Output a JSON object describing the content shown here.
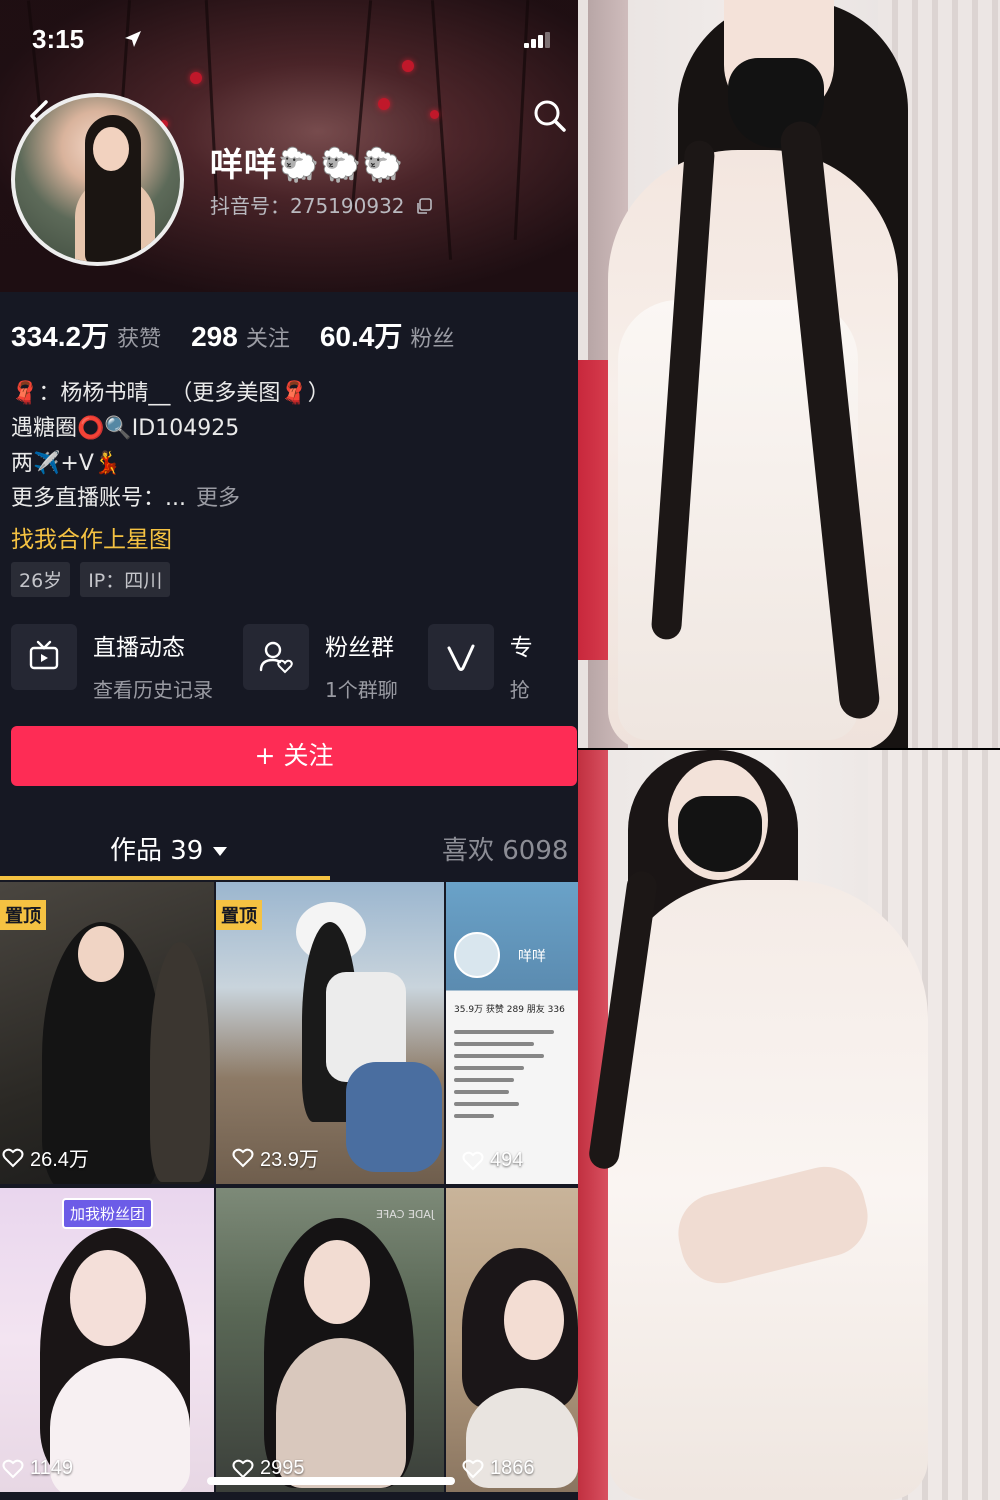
{
  "status_bar": {
    "time": "3:15"
  },
  "profile": {
    "nickname": "咩咩🐑🐑🐑",
    "douyin_id": "抖音号：275190932",
    "stats": [
      {
        "value": "334.2万",
        "label": "获赞"
      },
      {
        "value": "298",
        "label": "关注"
      },
      {
        "value": "60.4万",
        "label": "粉丝"
      }
    ],
    "bio_lines": [
      "🧣：杨杨书晴__（更多美图🧣）",
      "遇糖圈⭕🔍ID104925",
      "两✈️+V💃",
      "更多直播账号：..."
    ],
    "bio_more": "更多",
    "star_link": "找我合作上星图",
    "tags": [
      "26岁",
      "IP：四川"
    ]
  },
  "features": [
    {
      "title": "直播动态",
      "subtitle": "查看历史记录"
    },
    {
      "title": "粉丝群",
      "subtitle": "1个群聊"
    },
    {
      "title": "专",
      "subtitle": "抢"
    }
  ],
  "follow_button": "+ 关注",
  "tabs": {
    "works": "作品 39",
    "likes": "喜欢 6098"
  },
  "grid": [
    {
      "pinned": "置顶",
      "likes": "26.4万"
    },
    {
      "pinned": "置顶",
      "likes": "23.9万"
    },
    {
      "pinned": "",
      "likes": "494"
    },
    {
      "pinned": "",
      "likes": "1149"
    },
    {
      "pinned": "",
      "likes": "2995"
    },
    {
      "pinned": "",
      "likes": "1866"
    }
  ],
  "grid_overlay_text": {
    "fan_group_sticker": "加我粉丝团",
    "preview_name": "咩咩",
    "preview_stats": "35.9万 获赞  289 朋友  336",
    "cafe_sign": "JADE CAFE"
  },
  "colors": {
    "background": "#161823",
    "follow": "#fe2c55",
    "accent_yellow": "#f5c242",
    "secondary_text": "#9a9ba3"
  }
}
